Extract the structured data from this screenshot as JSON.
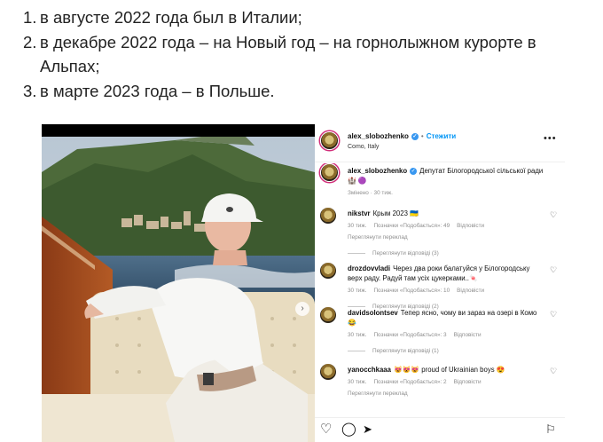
{
  "article": {
    "items": [
      {
        "num": "1.",
        "text": "в августе 2022 года был в Италии;"
      },
      {
        "num": "2.",
        "text": "в декабре 2022 года – на Новый год – на горнолыжном курорте в Альпах;"
      },
      {
        "num": "3.",
        "text": "в марте 2023 года – в Польше."
      }
    ]
  },
  "post": {
    "header": {
      "username": "alex_slobozhenko",
      "dot": "•",
      "follow_label": "Стежити",
      "location": "Como, Italy",
      "more_icon": "more-horizontal-icon"
    },
    "caption": {
      "username": "alex_slobozhenko",
      "text": "Депутат Білогородської сільської ради 🏰 🟣",
      "meta_edited": "Змінено · 30 тиж."
    },
    "comments": [
      {
        "username": "nikstvr",
        "text": "Крым 2023 🇺🇦",
        "time": "30 тиж.",
        "likes": "Позначки «Подобається»: 49",
        "reply": "Відповісти",
        "translate": "Переглянути переклад",
        "replies": "Переглянути відповіді (3)"
      },
      {
        "username": "drozdovvladi",
        "text": "Через два роки балатуйся у Білогородську верх раду. Радуй там усіх цукерками..🍬",
        "time": "30 тиж.",
        "likes": "Позначки «Подобається»: 10",
        "reply": "Відповісти",
        "translate": "",
        "replies": "Переглянути відповіді (2)"
      },
      {
        "username": "davidsolontsev",
        "text": "Тепер ясно, чому ви зараз на озері в Комо 😂",
        "time": "30 тиж.",
        "likes": "Позначки «Подобається»: 3",
        "reply": "Відповісти",
        "translate": "",
        "replies": "Переглянути відповіді (1)"
      },
      {
        "username": "yanocchkaaa",
        "text": "😻😻😻 proud of Ukrainian boys 😍",
        "time": "30 тиж.",
        "likes": "Позначки «Подобається»: 2",
        "reply": "Відповісти",
        "translate": "Переглянути переклад",
        "replies": ""
      }
    ],
    "actions": {
      "like_icon": "heart-icon",
      "comment_icon": "comment-icon",
      "share_icon": "send-icon",
      "save_icon": "bookmark-icon"
    },
    "carousel_icon": "chevron-right-icon"
  },
  "colors": {
    "link": "#0095f6",
    "verified": "#3897f0",
    "muted": "#8e8e8e"
  }
}
